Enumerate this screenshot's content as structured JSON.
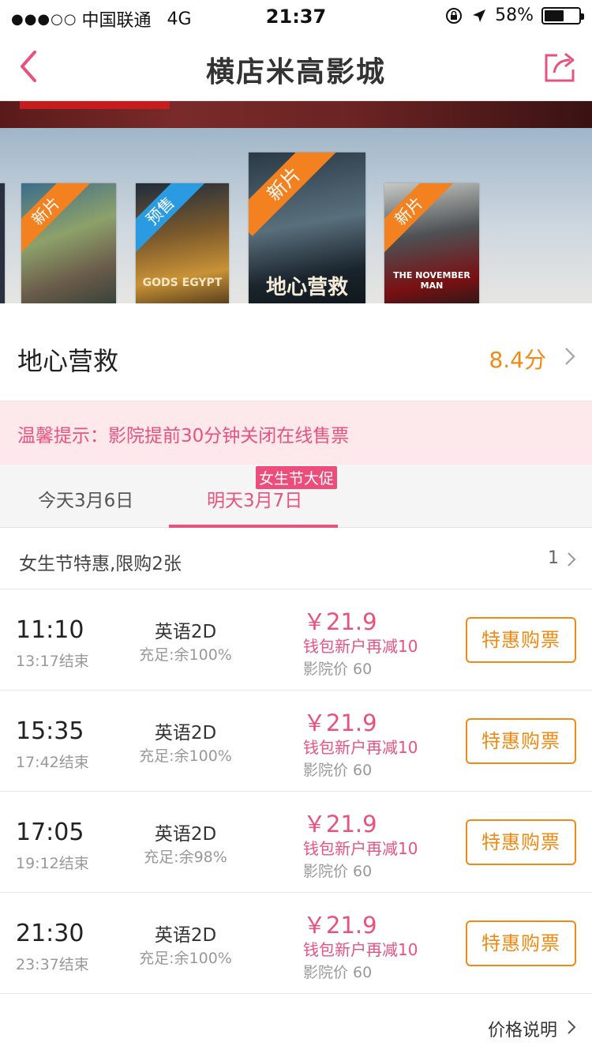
{
  "status_bar": {
    "signal_dots": "●●●○○",
    "carrier": "中国联通",
    "network": "4G",
    "time": "21:37",
    "battery": "58%",
    "battery_level": 0.58
  },
  "header": {
    "title": "横店米高影城",
    "back_icon": "chevron-left-icon",
    "share_icon": "share-icon"
  },
  "posters": [
    {
      "badge": "新片",
      "badge_color": "#f4811f"
    },
    {
      "badge": "预售",
      "badge_color": "#2a9be0",
      "poster_text": "GODS EGYPT"
    },
    {
      "badge": "新片",
      "badge_color": "#f4811f",
      "poster_text": "地心营救"
    },
    {
      "badge": "新片",
      "badge_color": "#f4811f",
      "poster_text": "THE NOVEMBER MAN"
    }
  ],
  "movie": {
    "name": "地心营救",
    "score": "8.4分"
  },
  "notice": "温馨提示：影院提前30分钟关闭在线售票",
  "tabs": [
    {
      "label": "今天3月6日"
    },
    {
      "label": "明天3月7日",
      "badge": "女生节大促",
      "selected": true
    }
  ],
  "promo": {
    "label": "女生节特惠,限购2张",
    "count": "1"
  },
  "showtimes": [
    {
      "start": "11:10",
      "end": "13:17结束",
      "lang": "英语2D",
      "seats": "充足:余100%",
      "price": "￥21.9",
      "discount": "钱包新户再减10",
      "cinema_price": "影院价  60",
      "button": "特惠购票"
    },
    {
      "start": "15:35",
      "end": "17:42结束",
      "lang": "英语2D",
      "seats": "充足:余100%",
      "price": "￥21.9",
      "discount": "钱包新户再减10",
      "cinema_price": "影院价  60",
      "button": "特惠购票"
    },
    {
      "start": "17:05",
      "end": "19:12结束",
      "lang": "英语2D",
      "seats": "充足:余98%",
      "price": "￥21.9",
      "discount": "钱包新户再减10",
      "cinema_price": "影院价  60",
      "button": "特惠购票"
    },
    {
      "start": "21:30",
      "end": "23:37结束",
      "lang": "英语2D",
      "seats": "充足:余100%",
      "price": "￥21.9",
      "discount": "钱包新户再减10",
      "cinema_price": "影院价  60",
      "button": "特惠购票"
    }
  ],
  "footer": {
    "price_note": "价格说明"
  },
  "colors": {
    "accent_pink": "#e8537e",
    "accent_orange": "#f08a14",
    "notice_bg": "#fde8ec"
  }
}
